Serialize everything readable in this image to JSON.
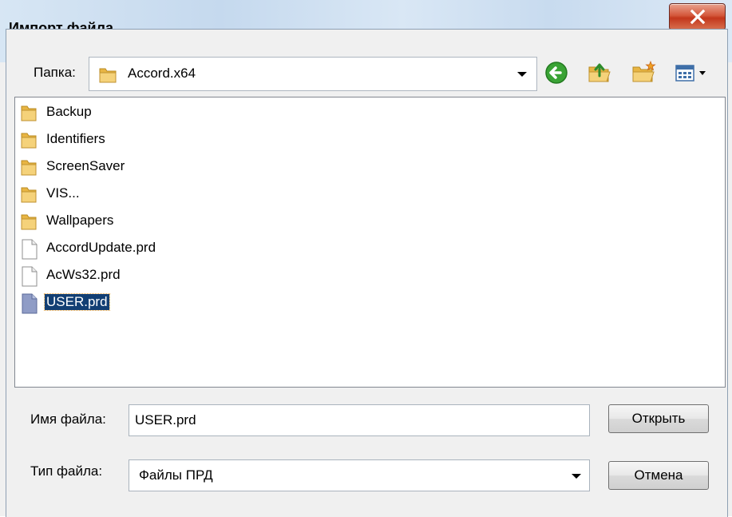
{
  "window": {
    "title": "Импорт файла"
  },
  "toolbar": {
    "folder_label": "Папка:",
    "folder_value": "Accord.x64"
  },
  "files": [
    {
      "name": "Backup",
      "type": "folder"
    },
    {
      "name": "Identifiers",
      "type": "folder"
    },
    {
      "name": "ScreenSaver",
      "type": "folder"
    },
    {
      "name": "VIS...",
      "type": "folder"
    },
    {
      "name": "Wallpapers",
      "type": "folder"
    },
    {
      "name": "AccordUpdate.prd",
      "type": "file"
    },
    {
      "name": "AcWs32.prd",
      "type": "file"
    },
    {
      "name": "USER.prd",
      "type": "file",
      "selected": true
    }
  ],
  "filename": {
    "label": "Имя файла:",
    "value": "USER.prd"
  },
  "filetype": {
    "label": "Тип файла:",
    "value": "Файлы ПРД"
  },
  "buttons": {
    "open": "Открыть",
    "cancel": "Отмена"
  },
  "colors": {
    "selection": "#123f74",
    "close_button": "#c94a2f"
  },
  "icons": [
    "close-icon",
    "folder-icon",
    "back-icon",
    "up-folder-icon",
    "new-folder-icon",
    "view-menu-icon",
    "file-icon"
  ]
}
